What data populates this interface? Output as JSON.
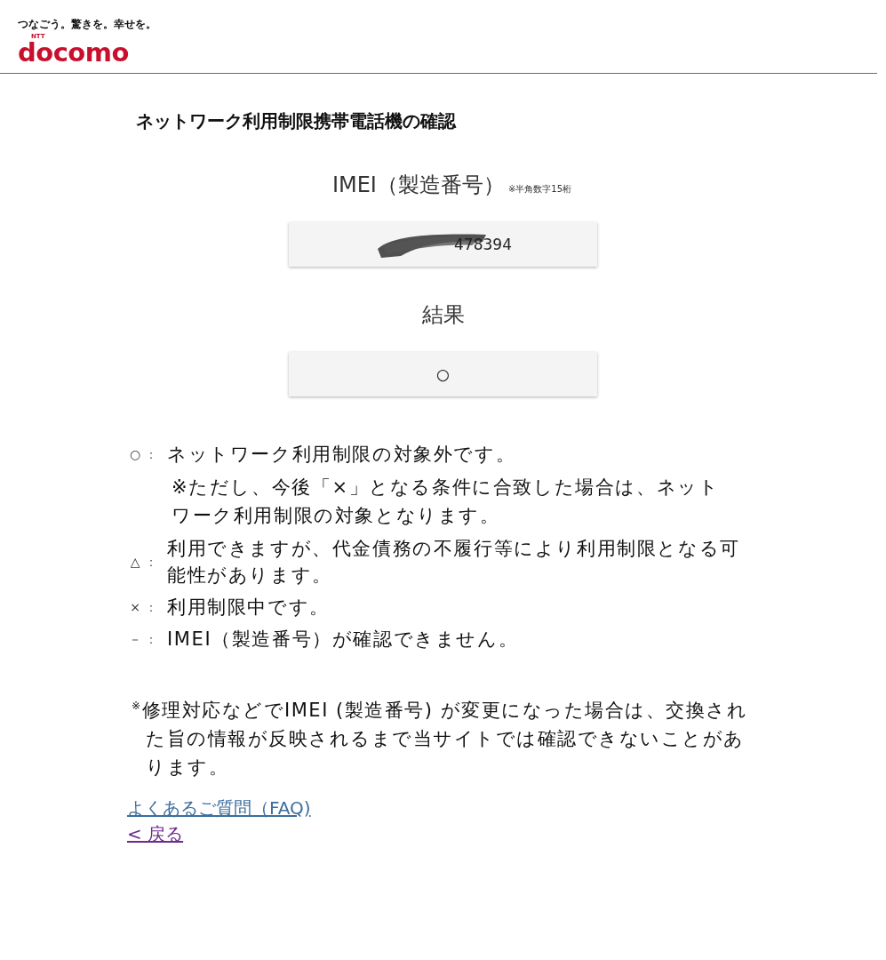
{
  "header": {
    "tagline": "つなごう。驚きを。幸せを。",
    "logo_mark": "NTT",
    "logo": "docomo"
  },
  "title": "ネットワーク利用制限携帯電話機の確認",
  "imei": {
    "label": "IMEI（製造番号）",
    "note": "※半角数字15桁",
    "value": "478394"
  },
  "result": {
    "label": "結果",
    "value": "○"
  },
  "legend": [
    {
      "symbol": "○",
      "separator": "：",
      "text": "ネットワーク利用制限の対象外です。",
      "note": "※ただし、今後「×」となる条件に合致した場合は、ネットワーク利用制限の対象となります。"
    },
    {
      "symbol": "△",
      "separator": "：",
      "text": "利用できますが、代金債務の不履行等により利用制限となる可能性があります。"
    },
    {
      "symbol": "×",
      "separator": "：",
      "text": "利用制限中です。"
    },
    {
      "symbol": "－",
      "separator": "：",
      "text": "IMEI（製造番号）が確認できません。"
    }
  ],
  "footnote": "$^{※}$修理対応などでIMEI (製造番号) が変更になった場合は、交換された旨の情報が反映されるまで当サイトでは確認できないことがあります。",
  "links": [
    {
      "label": "よくあるご質問（FAQ)",
      "visited": false
    },
    {
      "label": "< 戻る",
      "visited": true
    }
  ]
}
